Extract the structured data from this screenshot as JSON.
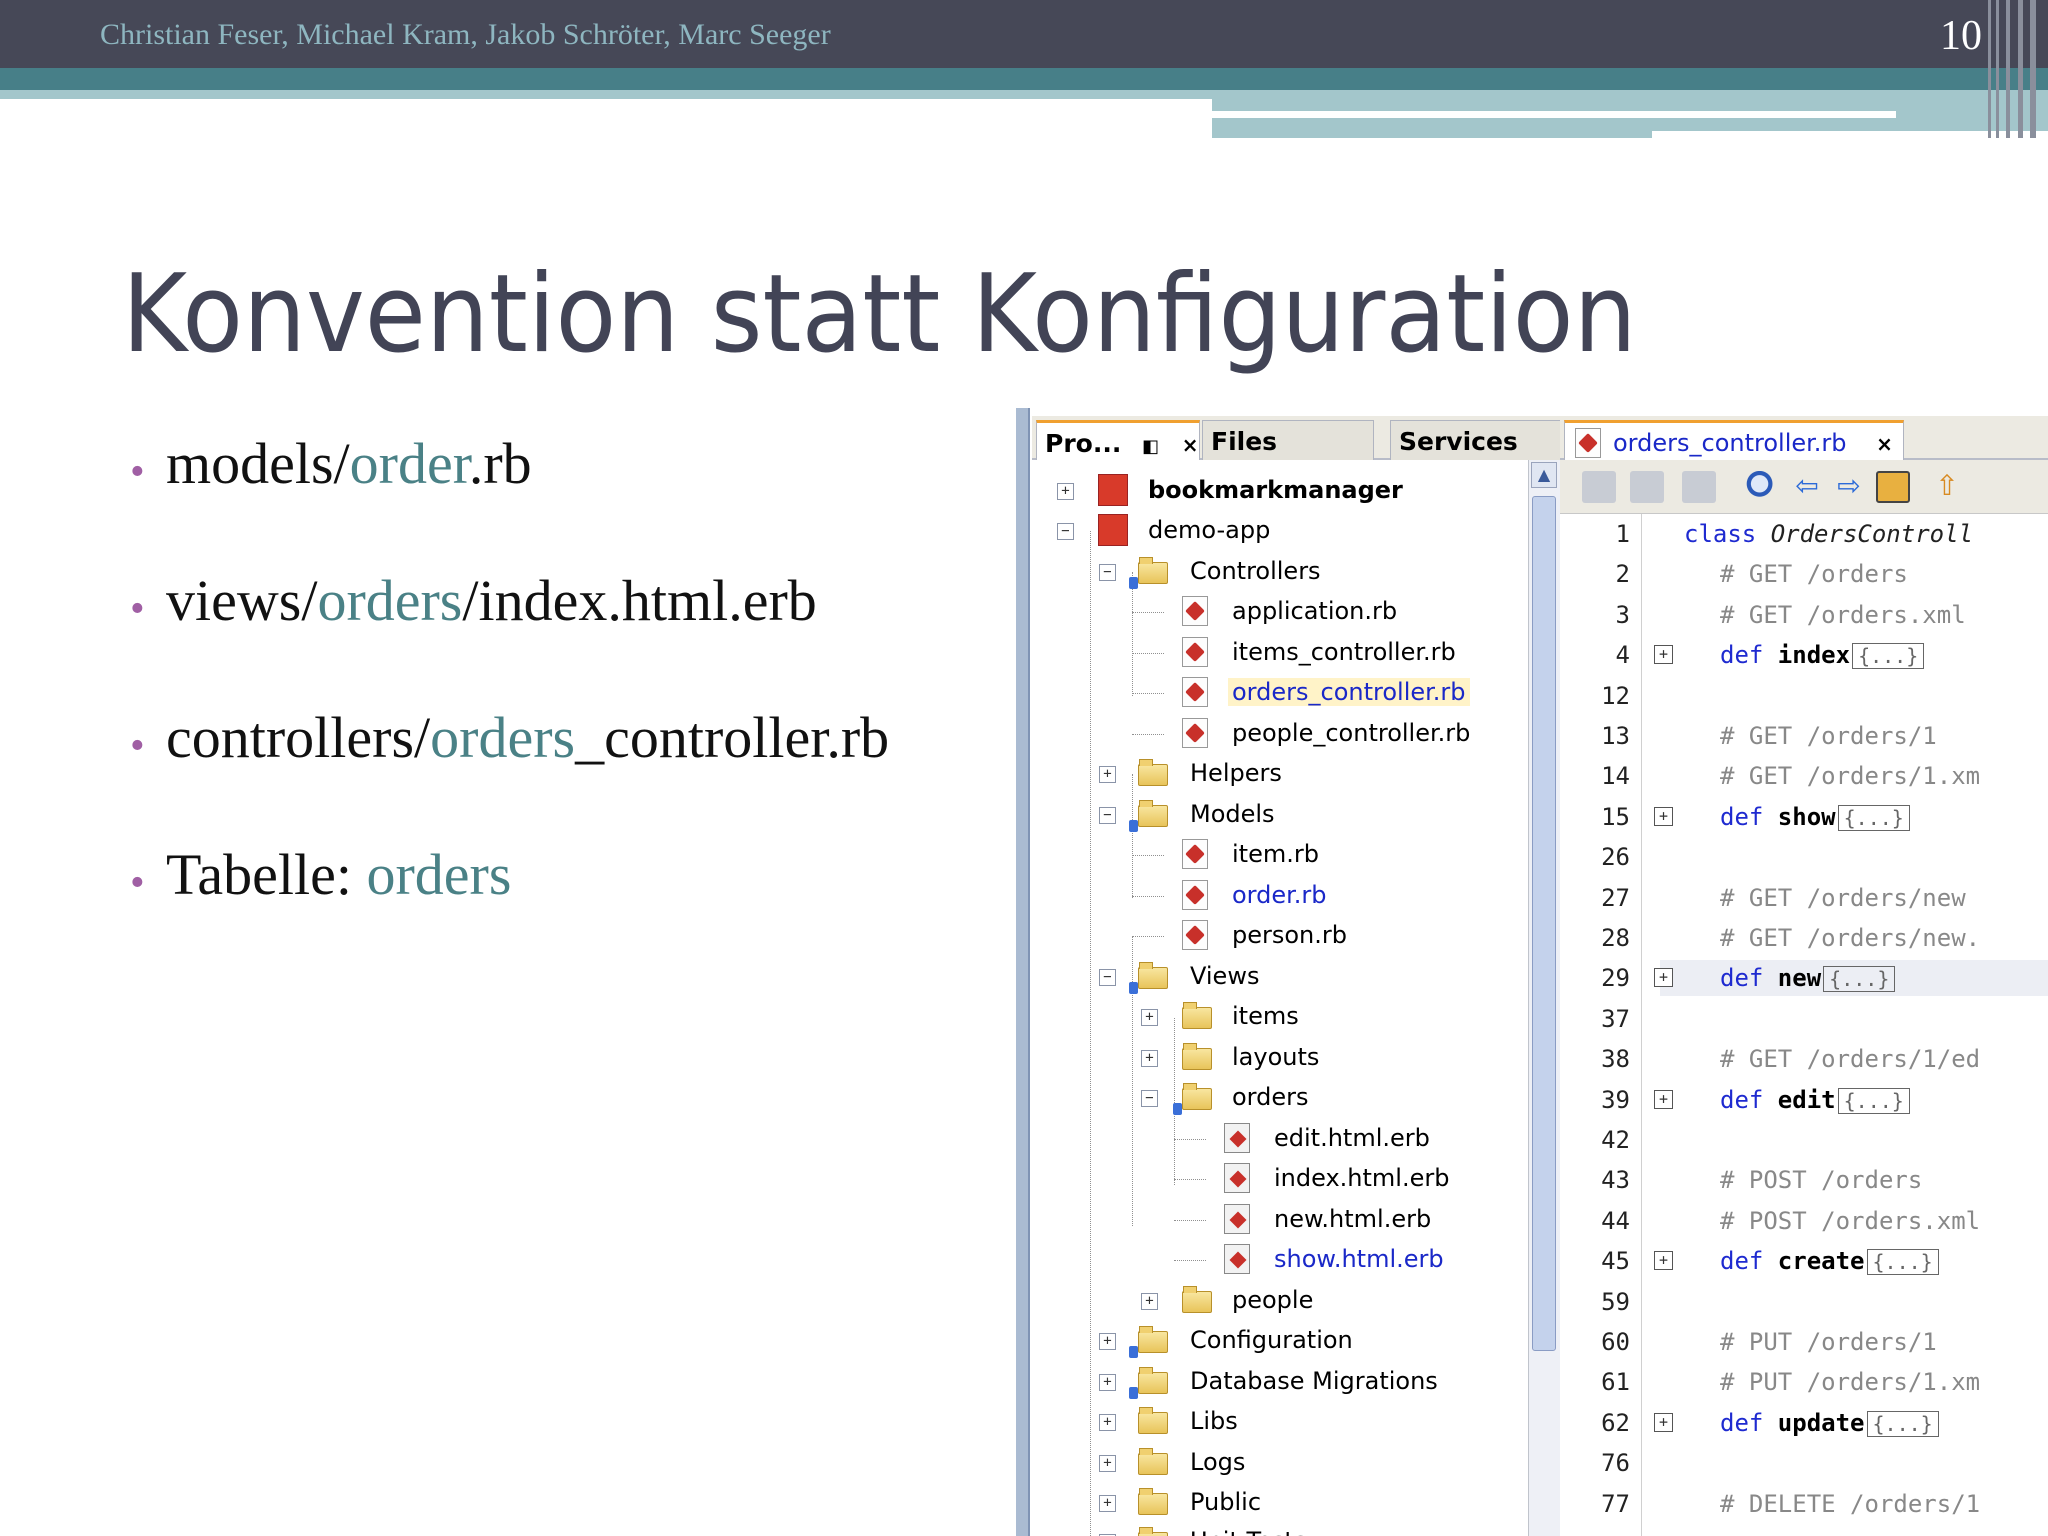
{
  "header": {
    "authors": "Christian Feser, Michael Kram, Jakob Schröter, Marc Seeger",
    "slide_number": "10"
  },
  "slide": {
    "title": "Konvention statt Konfiguration",
    "bullets": [
      {
        "pre": "models/",
        "hl": "order",
        "post": ".rb"
      },
      {
        "pre": "views/",
        "hl": "orders",
        "post": "/index.html.erb"
      },
      {
        "pre": "controllers/",
        "hl": "orders",
        "post": "_controller.rb"
      },
      {
        "pre": "Tabelle: ",
        "hl": "orders",
        "post": ""
      }
    ],
    "colors": {
      "title": "#424456",
      "highlight": "#4a8186",
      "bullet": "#a05fa4",
      "header_bg": "#464857"
    }
  },
  "ide": {
    "project_tabs": {
      "projects": "Pro...",
      "files": "Files",
      "services": "Services",
      "close": "×"
    },
    "tree": {
      "bookmarkmanager": "bookmarkmanager",
      "demo_app": "demo-app",
      "controllers": "Controllers",
      "application_rb": "application.rb",
      "items_controller_rb": "items_controller.rb",
      "orders_controller_rb": "orders_controller.rb",
      "people_controller_rb": "people_controller.rb",
      "helpers": "Helpers",
      "models": "Models",
      "item_rb": "item.rb",
      "order_rb": "order.rb",
      "person_rb": "person.rb",
      "views": "Views",
      "items": "items",
      "layouts": "layouts",
      "orders": "orders",
      "edit_html_erb": "edit.html.erb",
      "index_html_erb": "index.html.erb",
      "new_html_erb": "new.html.erb",
      "show_html_erb": "show.html.erb",
      "people": "people",
      "configuration": "Configuration",
      "database_migrations": "Database Migrations",
      "libs": "Libs",
      "logs": "Logs",
      "public": "Public",
      "unit_tests": "Unit Tests"
    },
    "editor": {
      "tab_label": "orders_controller.rb",
      "tab_close": "×",
      "collapsed_marker": "{...}",
      "lines": [
        {
          "n": "1",
          "kw": "class",
          "rest": " OrdersControll"
        },
        {
          "n": "2",
          "comment": "# GET /orders"
        },
        {
          "n": "3",
          "comment": "# GET /orders.xml"
        },
        {
          "n": "4",
          "kw": "def",
          "name": " index",
          "fold": true
        },
        {
          "n": "12"
        },
        {
          "n": "13",
          "comment": "# GET /orders/1"
        },
        {
          "n": "14",
          "comment": "# GET /orders/1.xm"
        },
        {
          "n": "15",
          "kw": "def",
          "name": " show",
          "fold": true
        },
        {
          "n": "26"
        },
        {
          "n": "27",
          "comment": "# GET /orders/new"
        },
        {
          "n": "28",
          "comment": "# GET /orders/new."
        },
        {
          "n": "29",
          "kw": "def",
          "name": " new",
          "fold": true,
          "current": true
        },
        {
          "n": "37"
        },
        {
          "n": "38",
          "comment": "# GET /orders/1/ed"
        },
        {
          "n": "39",
          "kw": "def",
          "name": " edit",
          "fold": true
        },
        {
          "n": "42"
        },
        {
          "n": "43",
          "comment": "# POST /orders"
        },
        {
          "n": "44",
          "comment": "# POST /orders.xml"
        },
        {
          "n": "45",
          "kw": "def",
          "name": " create",
          "fold": true
        },
        {
          "n": "59"
        },
        {
          "n": "60",
          "comment": "# PUT /orders/1"
        },
        {
          "n": "61",
          "comment": "# PUT /orders/1.xm"
        },
        {
          "n": "62",
          "kw": "def",
          "name": " update",
          "fold": true
        },
        {
          "n": "76"
        },
        {
          "n": "77",
          "comment": "# DELETE /orders/1"
        }
      ]
    }
  }
}
